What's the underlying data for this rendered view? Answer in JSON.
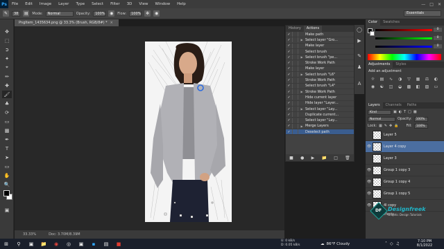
{
  "app": {
    "logo": "Ps",
    "menus": [
      "File",
      "Edit",
      "Image",
      "Layer",
      "Type",
      "Select",
      "Filter",
      "3D",
      "View",
      "Window",
      "Help"
    ]
  },
  "options": {
    "brush_size": "38",
    "mode_label": "Mode:",
    "mode_value": "Normal",
    "opacity_label": "Opacity:",
    "opacity_value": "100%",
    "flow_label": "Flow:",
    "flow_value": "100%",
    "workspace": "Essentials"
  },
  "document": {
    "tab_title": "PngItem_1435634.png @ 33.3% (Brush, RGB/8#) *",
    "zoom": "33.33%",
    "doc_info": "Doc: 3.70M/8.39M"
  },
  "actions_panel": {
    "tabs": [
      "History",
      "Actions"
    ],
    "items": [
      {
        "text": "Make path",
        "selected": false
      },
      {
        "text": "Select layer \"Gro...",
        "selected": false
      },
      {
        "text": "Make layer",
        "selected": false
      },
      {
        "text": "Select brush",
        "selected": false
      },
      {
        "text": "Select brush \"pe...",
        "selected": false
      },
      {
        "text": "Stroke Work Path",
        "selected": false
      },
      {
        "text": "Make layer",
        "selected": false
      },
      {
        "text": "Select brush \"L6\"",
        "selected": false
      },
      {
        "text": "Stroke Work Path",
        "selected": false
      },
      {
        "text": "Select brush \"L4\"",
        "selected": false
      },
      {
        "text": "Stroke Work Path",
        "selected": false
      },
      {
        "text": "Hide current layer",
        "selected": false
      },
      {
        "text": "Hide layer \"Layer...",
        "selected": false
      },
      {
        "text": "Select layer \"Lay...",
        "selected": false
      },
      {
        "text": "Duplicate current...",
        "selected": false
      },
      {
        "text": "Select layer \"Lay...",
        "selected": false
      },
      {
        "text": "Merge Layers",
        "selected": false
      },
      {
        "text": "Deselect path",
        "selected": true
      }
    ]
  },
  "color_panel": {
    "tabs": [
      "Color",
      "Swatches"
    ],
    "r": "0",
    "g": "0",
    "b": "0"
  },
  "adjustments_panel": {
    "tabs": [
      "Adjustments",
      "Styles"
    ],
    "title": "Add an adjustment"
  },
  "layers_panel": {
    "tabs": [
      "Layers",
      "Channels",
      "Paths"
    ],
    "kind": "Kind",
    "blend_mode": "Normal",
    "opacity_label": "Opacity:",
    "opacity_value": "100%",
    "lock_label": "Lock:",
    "fill_label": "Fill:",
    "fill_value": "100%",
    "layers": [
      {
        "name": "Layer 5",
        "visible": false,
        "selected": false
      },
      {
        "name": "Layer 4 copy",
        "visible": true,
        "selected": true
      },
      {
        "name": "Layer 3",
        "visible": false,
        "selected": false
      },
      {
        "name": "Group 1 copy 3",
        "visible": true,
        "selected": false
      },
      {
        "name": "Group 1 copy 4",
        "visible": true,
        "selected": false
      },
      {
        "name": "Group 1 copy 5",
        "visible": true,
        "selected": false
      },
      {
        "name": "4l copy",
        "visible": true,
        "selected": false
      }
    ],
    "effects_label": "Effects"
  },
  "watermark": {
    "logo": "DF",
    "brand": "Designfreek",
    "tagline": "Graphic Design Tutorials"
  },
  "taskbar": {
    "net_up": "0 kB/s",
    "net_down": "0.05 kB/s",
    "net_up_label": "U:",
    "net_down_label": "D:",
    "weather": "86°F  Cloudy",
    "time": "7:10 PM",
    "date": "8/1/2022"
  }
}
